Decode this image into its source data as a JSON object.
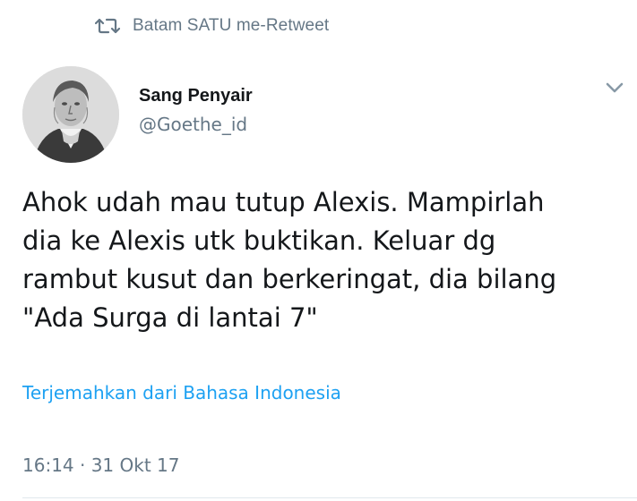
{
  "retweet": {
    "icon": "retweet-icon",
    "text": "Batam SATU me-Retweet"
  },
  "author": {
    "avatar_icon": "avatar-portrait",
    "display_name": "Sang Penyair",
    "handle": "@Goethe_id"
  },
  "menu": {
    "icon": "chevron-down-icon"
  },
  "tweet": {
    "text": "Ahok udah mau tutup Alexis. Mampirlah\ndia ke Alexis utk buktikan. Keluar dg\nrambut kusut dan berkeringat, dia bilang\n\"Ada Surga di lantai 7\""
  },
  "translate": {
    "label": "Terjemahkan dari Bahasa Indonesia"
  },
  "meta": {
    "timestamp": "16:14 · 31 Okt 17"
  },
  "colors": {
    "text": "#14171a",
    "muted": "#657786",
    "link": "#1da1f2",
    "divider": "#e1e8ed"
  }
}
